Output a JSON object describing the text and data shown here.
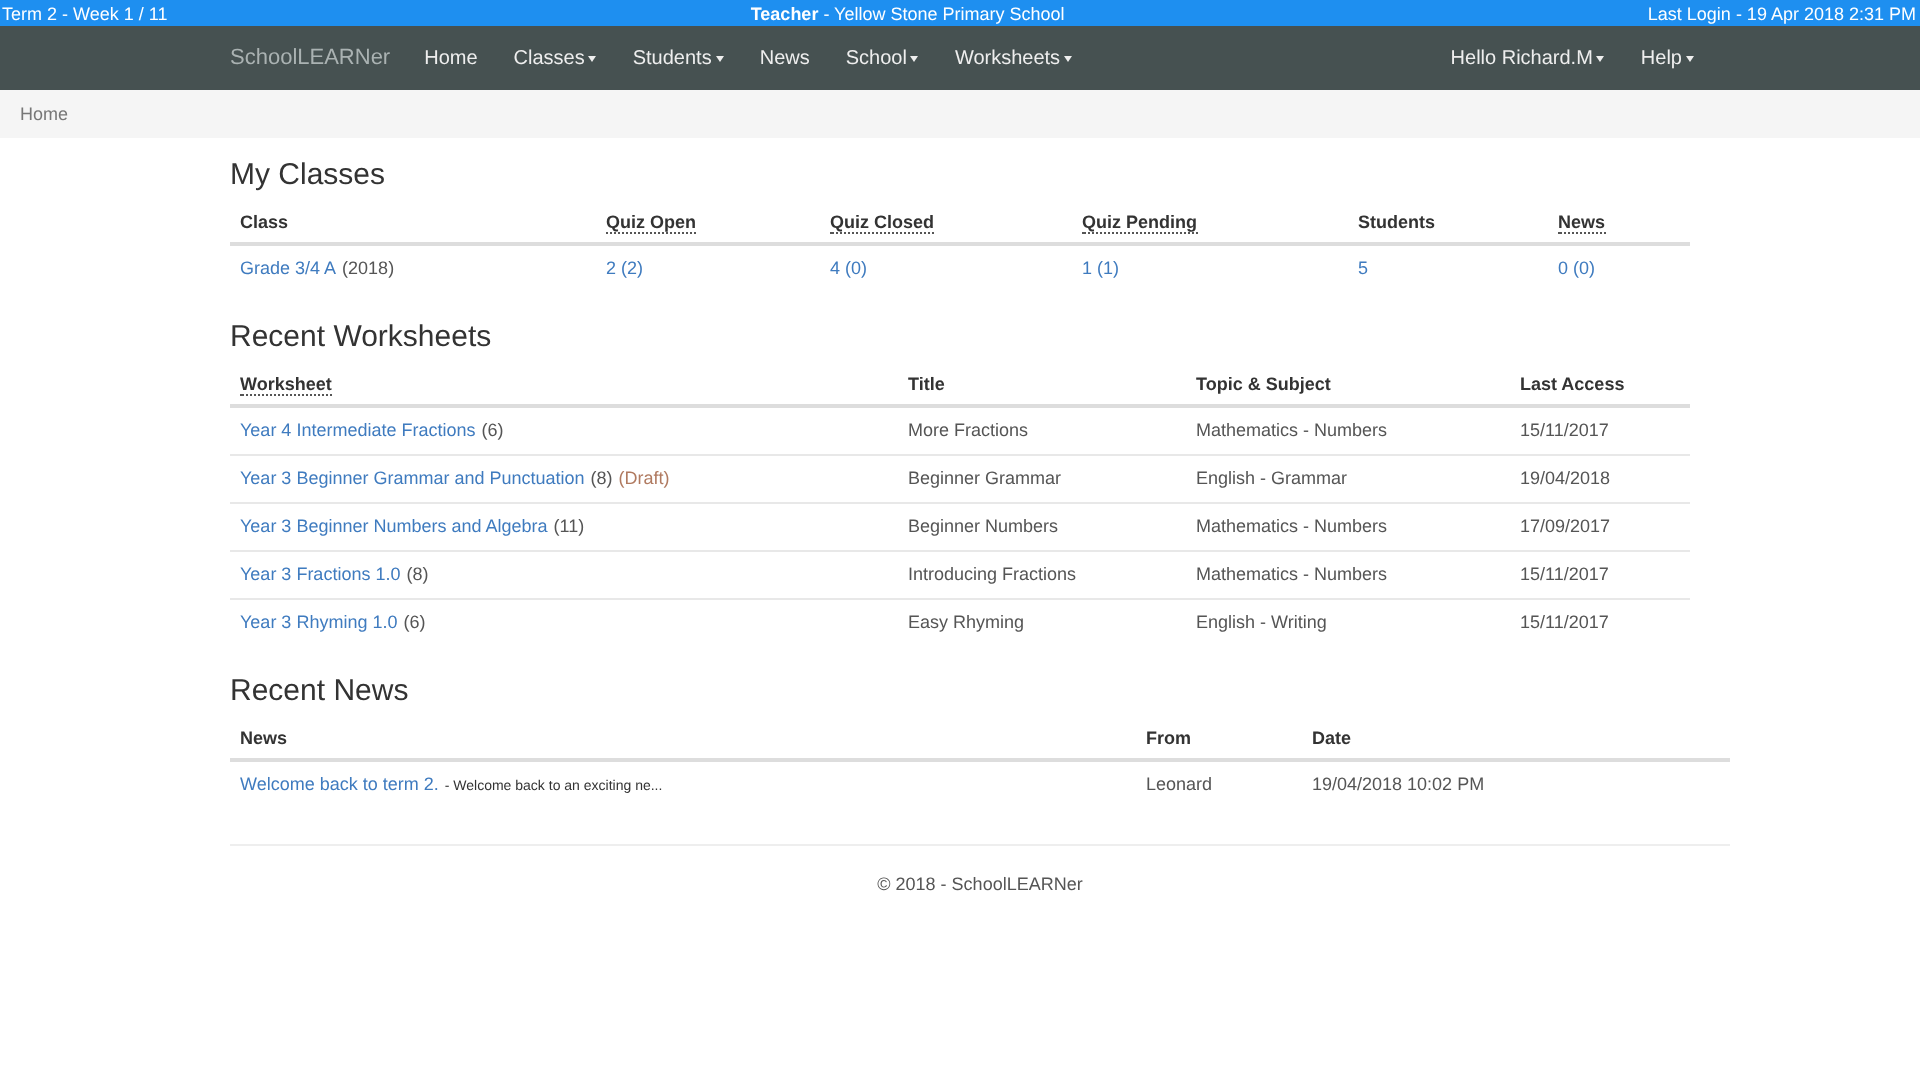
{
  "top_bar": {
    "term": "Term 2 - Week 1 / 11",
    "role": "Teacher",
    "school": "- Yellow Stone Primary School",
    "last_login": "Last Login - 19 Apr 2018 2:31 PM"
  },
  "navbar": {
    "logo": "SchoolLEARNer",
    "items": [
      {
        "label": "Home",
        "dropdown": false
      },
      {
        "label": "Classes",
        "dropdown": true
      },
      {
        "label": "Students",
        "dropdown": true
      },
      {
        "label": "News",
        "dropdown": false
      },
      {
        "label": "School",
        "dropdown": true
      },
      {
        "label": "Worksheets",
        "dropdown": true
      }
    ],
    "right_items": [
      {
        "label": "Hello Richard.M",
        "dropdown": true
      },
      {
        "label": "Help",
        "dropdown": true
      }
    ]
  },
  "breadcrumb": [
    "Home"
  ],
  "sections": [
    {
      "title": "My Classes",
      "columns": [
        {
          "label": "Class",
          "sortable": false
        },
        {
          "label": "Quiz Open",
          "sortable": true
        },
        {
          "label": "Quiz Closed",
          "sortable": true
        },
        {
          "label": "Quiz Pending",
          "sortable": true
        },
        {
          "label": "Students",
          "sortable": false
        },
        {
          "label": "News",
          "sortable": true
        }
      ],
      "rows": [
        [
          {
            "link": "Grade 3/4 A",
            "text": "(2018)"
          },
          {
            "link": "2 (2)"
          },
          {
            "link": "4 (0)"
          },
          {
            "link": "1 (1)"
          },
          {
            "link": "5"
          },
          {
            "link": "0 (0)"
          }
        ]
      ]
    },
    {
      "title": "Recent Worksheets",
      "columns": [
        {
          "label": "Worksheet",
          "sortable": true
        },
        {
          "label": "Title",
          "sortable": false
        },
        {
          "label": "Topic & Subject",
          "sortable": false
        },
        {
          "label": "Last Access",
          "sortable": false
        }
      ],
      "rows": [
        [
          {
            "link": "Year 4 Intermediate Fractions",
            "text": "(6)"
          },
          {
            "text": "More Fractions"
          },
          {
            "text": "Mathematics - Numbers"
          },
          {
            "text": "15/11/2017"
          }
        ],
        [
          {
            "link": "Year 3 Beginner Grammar and Punctuation",
            "text": "(8)",
            "flag": "(Draft)"
          },
          {
            "text": "Beginner Grammar"
          },
          {
            "text": "English - Grammar"
          },
          {
            "text": "19/04/2018"
          }
        ],
        [
          {
            "link": "Year 3 Beginner Numbers and Algebra",
            "text": "(11)"
          },
          {
            "text": "Beginner Numbers"
          },
          {
            "text": "Mathematics - Numbers"
          },
          {
            "text": "17/09/2017"
          }
        ],
        [
          {
            "link": "Year 3 Fractions 1.0",
            "text": "(8)"
          },
          {
            "text": "Introducing Fractions"
          },
          {
            "text": "Mathematics - Numbers"
          },
          {
            "text": "15/11/2017"
          }
        ],
        [
          {
            "link": "Year 3 Rhyming 1.0",
            "text": "(6)"
          },
          {
            "text": "Easy Rhyming"
          },
          {
            "text": "English - Writing"
          },
          {
            "text": "15/11/2017"
          }
        ]
      ]
    },
    {
      "title": "Recent News",
      "columns": [
        {
          "label": "News",
          "sortable": false
        },
        {
          "label": "From",
          "sortable": false
        },
        {
          "label": "Date",
          "sortable": false
        }
      ],
      "rows": [
        [
          {
            "link": "Welcome back to term 2.",
            "small": "- Welcome back to an exciting ne..."
          },
          {
            "text": "Leonard"
          },
          {
            "text": "19/04/2018 10:02 PM"
          }
        ]
      ]
    }
  ],
  "footer": "© 2018 - SchoolLEARNer"
}
